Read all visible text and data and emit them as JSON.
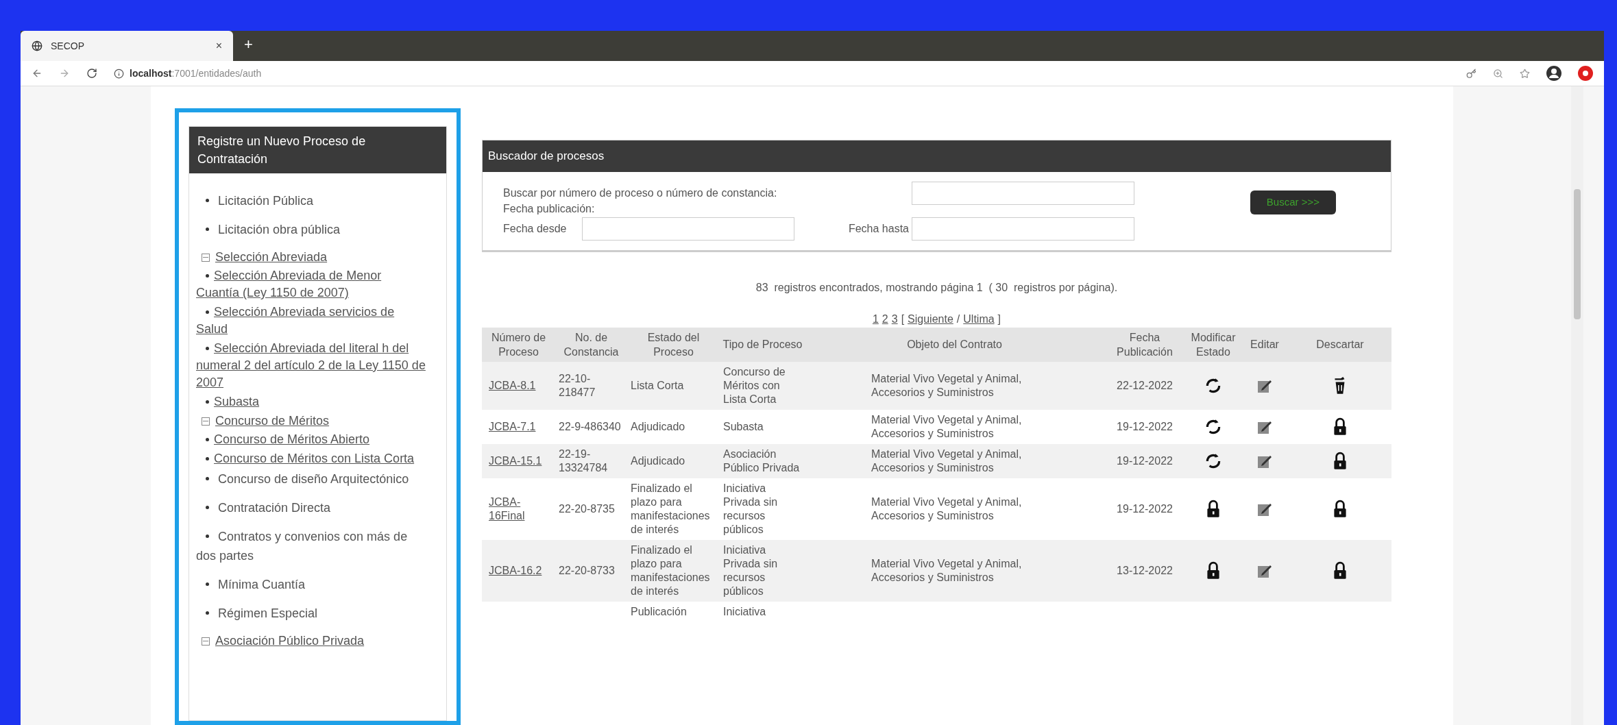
{
  "browser": {
    "tab_title": "SECOP",
    "tab_close": "×",
    "new_tab": "+",
    "url_host": "localhost",
    "url_path": ":7001/entidades/auth"
  },
  "sidebar": {
    "title": "Registre un Nuevo Proceso de Contratación",
    "items": [
      {
        "kind": "plain",
        "label": "Licitación Pública"
      },
      {
        "kind": "plain",
        "label": "Licitación obra pública"
      },
      {
        "kind": "group",
        "label": "Selección Abreviada"
      },
      {
        "kind": "link",
        "label": "Selección Abreviada de Menor Cuantía (Ley 1150 de 2007)"
      },
      {
        "kind": "link",
        "label": "Selección Abreviada servicios de Salud"
      },
      {
        "kind": "link",
        "label": "Selección Abreviada del literal h del numeral 2 del artículo 2 de la Ley 1150 de 2007"
      },
      {
        "kind": "link",
        "label": "Subasta"
      },
      {
        "kind": "group",
        "label": "Concurso de Méritos"
      },
      {
        "kind": "link",
        "label": "Concurso de Méritos Abierto"
      },
      {
        "kind": "link",
        "label": "Concurso de Méritos con Lista Corta"
      },
      {
        "kind": "plain",
        "label": "Concurso de diseño Arquitectónico"
      },
      {
        "kind": "plain",
        "label": "Contratación Directa"
      },
      {
        "kind": "plain",
        "label": "Contratos y convenios con más de dos partes"
      },
      {
        "kind": "plain",
        "label": "Mínima Cuantía"
      },
      {
        "kind": "plain",
        "label": "Régimen Especial"
      },
      {
        "kind": "group",
        "label": "Asociación Público Privada"
      }
    ]
  },
  "search": {
    "title": "Buscador de procesos",
    "number_label": "Buscar por número de proceso o número de constancia:",
    "date_label": "Fecha publicación:",
    "from_label": "Fecha desde",
    "to_label": "Fecha hasta",
    "button": "Buscar >>>"
  },
  "results": {
    "summary": "83  registros encontrados, mostrando página 1  ( 30  registros por página).",
    "pagination": [
      {
        "kind": "link",
        "text": "1"
      },
      {
        "kind": "link",
        "text": "2"
      },
      {
        "kind": "link",
        "text": "3"
      },
      {
        "kind": "text",
        "text": "["
      },
      {
        "kind": "link",
        "text": "Siguiente"
      },
      {
        "kind": "text",
        "text": "/"
      },
      {
        "kind": "link",
        "text": "Ultima"
      },
      {
        "kind": "text",
        "text": "]"
      }
    ]
  },
  "table": {
    "columns": [
      "Número de Proceso",
      "No. de Constancia",
      "Estado del Proceso",
      "Tipo de Proceso",
      "Objeto del Contrato",
      "Fecha Publicación",
      "Modificar Estado",
      "Editar",
      "Descartar"
    ],
    "rows": [
      {
        "process": "JCBA-8.1",
        "constancia": "22-10-\n218477",
        "estado": "Lista Corta",
        "tipo": "Concurso de Méritos con Lista Corta",
        "objeto": "Material Vivo Vegetal y Animal, Accesorios y Suministros",
        "fecha": "22-12-2022",
        "actions": [
          {
            "kind": "refresh"
          },
          {
            "kind": "edit"
          },
          {
            "kind": "discard"
          }
        ]
      },
      {
        "process": "JCBA-7.1",
        "constancia": "22-9-486340",
        "estado": "Adjudicado",
        "tipo": "Subasta",
        "objeto": "Material Vivo Vegetal y Animal, Accesorios y Suministros",
        "fecha": "19-12-2022",
        "actions": [
          {
            "kind": "refresh"
          },
          {
            "kind": "edit"
          },
          {
            "kind": "lock"
          }
        ]
      },
      {
        "process": "JCBA-15.1",
        "constancia": "22-19-\n13324784",
        "estado": "Adjudicado",
        "tipo": "Asociación Público Privada",
        "objeto": "Material Vivo Vegetal y Animal, Accesorios y Suministros",
        "fecha": "19-12-2022",
        "actions": [
          {
            "kind": "refresh"
          },
          {
            "kind": "edit"
          },
          {
            "kind": "lock"
          }
        ]
      },
      {
        "process": "JCBA-\n16Final",
        "constancia": "22-20-8735",
        "estado": "Finalizado el plazo para manifestaciones de interés",
        "tipo": "Iniciativa Privada sin recursos públicos",
        "objeto": "Material Vivo Vegetal y Animal, Accesorios y Suministros",
        "fecha": "19-12-2022",
        "actions": [
          {
            "kind": "lock"
          },
          {
            "kind": "edit"
          },
          {
            "kind": "lock"
          }
        ]
      },
      {
        "process": "JCBA-16.2",
        "constancia": "22-20-8733",
        "estado": "Finalizado el plazo para manifestaciones de interés",
        "tipo": "Iniciativa Privada sin recursos públicos",
        "objeto": "Material Vivo Vegetal y Animal, Accesorios y Suministros",
        "fecha": "13-12-2022",
        "actions": [
          {
            "kind": "lock"
          },
          {
            "kind": "edit"
          },
          {
            "kind": "lock"
          }
        ]
      },
      {
        "estado": "Publicación",
        "tipo": "Iniciativa"
      }
    ]
  }
}
